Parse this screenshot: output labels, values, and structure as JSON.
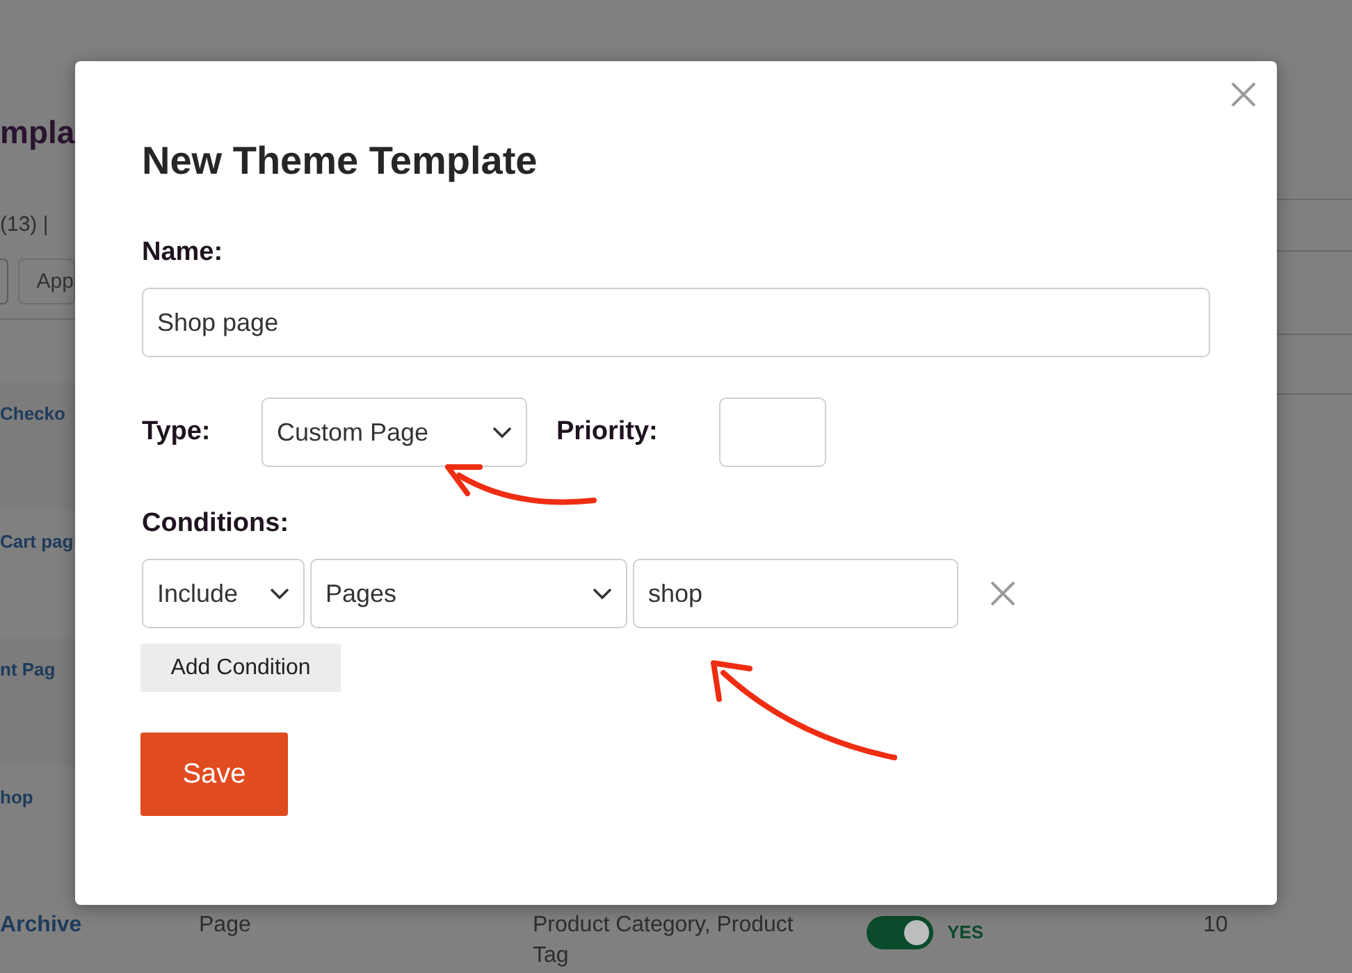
{
  "background_page": {
    "title_fragment": "mpla",
    "count_fragment": "(13) |",
    "button_fragment": "App",
    "rows": [
      {
        "name": "Checko"
      },
      {
        "name": "Cart pag"
      },
      {
        "name": "nt Pag"
      },
      {
        "name": "hop"
      }
    ],
    "last_row": {
      "name": "Archive",
      "type": "Page",
      "conditions": "Product Category, Product Tag",
      "on": true,
      "status": "YES",
      "priority": "10"
    }
  },
  "dialog": {
    "title": "New Theme Template",
    "name_label": "Name:",
    "name_value": "Shop page",
    "type_label": "Type:",
    "type_value": "Custom Page",
    "priority_label": "Priority:",
    "conditions_label": "Conditions:",
    "conditions": [
      {
        "mode": "Include",
        "target": "Pages",
        "value": "shop"
      }
    ],
    "add_button": "Add Condition",
    "save_button": "Save"
  }
}
